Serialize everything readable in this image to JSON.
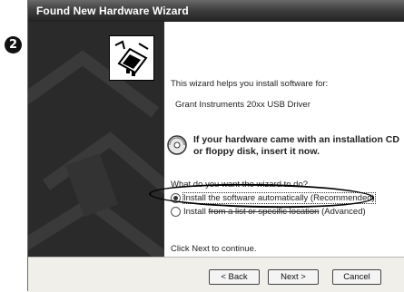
{
  "step_number": "2",
  "window": {
    "title": "Found New Hardware Wizard"
  },
  "content": {
    "intro": "This wizard helps you install software for:",
    "device_name": "Grant Instruments 20xx USB Driver",
    "cd_prompt_line1": "If your hardware came with an installation CD",
    "cd_prompt_line2": "or floppy disk, insert it now.",
    "question": "What do you want the wizard to do?",
    "option_auto": "Install the software automatically (Recommended)",
    "option_list_prefix": "Install ",
    "option_list_obscured": "from a list or specific location",
    "option_list_suffix": " (Advanced)",
    "continue_hint": "Click Next to continue."
  },
  "buttons": {
    "back": "< Back",
    "next": "Next >",
    "cancel": "Cancel"
  },
  "icons": {
    "wizard": "hardware-card-icon",
    "cd": "cd-disc-icon"
  }
}
